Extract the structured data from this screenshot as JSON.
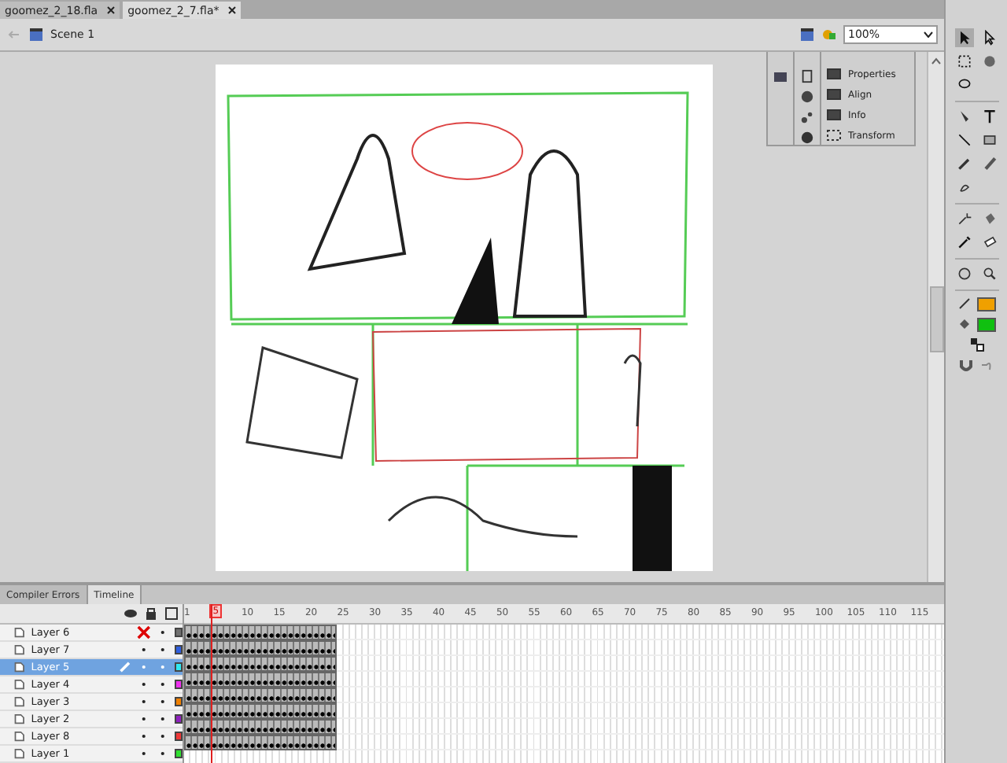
{
  "document_tabs": [
    {
      "label": "goomez_2_18.fla",
      "selected": false
    },
    {
      "label": "goomez_2_7.fla*",
      "selected": true
    }
  ],
  "edit_bar": {
    "scene": "Scene 1",
    "zoom": "100%"
  },
  "panel": {
    "items": [
      {
        "label": "Properties"
      },
      {
        "label": "Align"
      },
      {
        "label": "Info"
      },
      {
        "label": "Transform"
      }
    ]
  },
  "tools": {
    "colors": [
      {
        "kind": "stroke",
        "color": "#f0a000"
      },
      {
        "kind": "fill",
        "color": "#10c010"
      }
    ]
  },
  "timeline": {
    "tabs": [
      {
        "label": "Compiler Errors",
        "selected": false
      },
      {
        "label": "Timeline",
        "selected": true
      }
    ],
    "ruler": [
      {
        "text": "1",
        "selected": false
      },
      {
        "text": "5",
        "selected": true
      },
      {
        "text": "10",
        "selected": false
      },
      {
        "text": "15",
        "selected": false
      },
      {
        "text": "20",
        "selected": false
      },
      {
        "text": "25",
        "selected": false
      },
      {
        "text": "30",
        "selected": false
      },
      {
        "text": "35",
        "selected": false
      },
      {
        "text": "40",
        "selected": false
      },
      {
        "text": "45",
        "selected": false
      },
      {
        "text": "50",
        "selected": false
      },
      {
        "text": "55",
        "selected": false
      },
      {
        "text": "60",
        "selected": false
      },
      {
        "text": "65",
        "selected": false
      },
      {
        "text": "70",
        "selected": false
      },
      {
        "text": "75",
        "selected": false
      },
      {
        "text": "80",
        "selected": false
      },
      {
        "text": "85",
        "selected": false
      },
      {
        "text": "90",
        "selected": false
      },
      {
        "text": "95",
        "selected": false
      },
      {
        "text": "100",
        "selected": false
      },
      {
        "text": "105",
        "selected": false
      },
      {
        "text": "110",
        "selected": false
      },
      {
        "text": "115",
        "selected": false
      }
    ],
    "layers": [
      {
        "name": "Layer 6",
        "selected": false,
        "visible": false,
        "color": "#707070"
      },
      {
        "name": "Layer 7",
        "selected": false,
        "visible": true,
        "color": "#2f5fe0"
      },
      {
        "name": "Layer 5",
        "selected": true,
        "visible": true,
        "color": "#30e8f0"
      },
      {
        "name": "Layer 4",
        "selected": false,
        "visible": true,
        "color": "#f030f0"
      },
      {
        "name": "Layer 3",
        "selected": false,
        "visible": true,
        "color": "#f08000"
      },
      {
        "name": "Layer 2",
        "selected": false,
        "visible": true,
        "color": "#9020c0"
      },
      {
        "name": "Layer 8",
        "selected": false,
        "visible": true,
        "color": "#f03838"
      },
      {
        "name": "Layer 1",
        "selected": false,
        "visible": true,
        "color": "#30e030"
      }
    ]
  }
}
